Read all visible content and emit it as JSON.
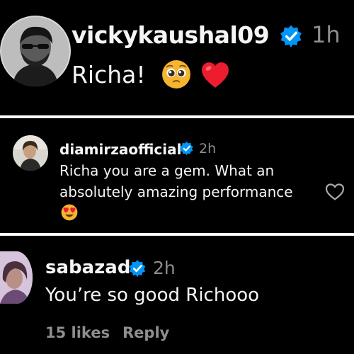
{
  "comments": [
    {
      "username": "vickykaushal09",
      "verified": true,
      "time": "1h",
      "text": "Richa!",
      "emojis": [
        "pleading-face-emoji",
        "red-heart-emoji"
      ]
    },
    {
      "username": "diamirzaofficial",
      "verified": true,
      "time": "2h",
      "text_lines": [
        "Richa you are a gem. What an",
        "absolutely amazing performance"
      ],
      "emojis": [
        "heart-eyes-emoji"
      ],
      "like_icon": "heart-outline-icon"
    },
    {
      "username": "sabazad",
      "verified": true,
      "time": "2h",
      "text": "You’re so good Richooo",
      "likes": "15 likes",
      "reply_label": "Reply"
    }
  ],
  "colors": {
    "background": "#000000",
    "text": "#f5f5f5",
    "secondary_text": "#8e8e8e",
    "verified_blue": "#0095f6",
    "heart_red": "#ed1c2e"
  }
}
